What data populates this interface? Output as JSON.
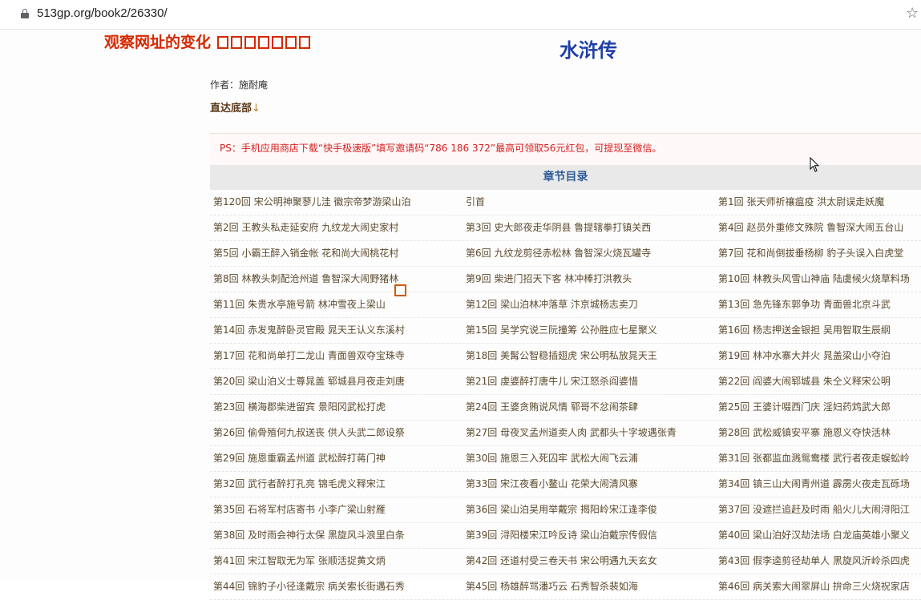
{
  "browser": {
    "url": "513gp.org/book2/26330/"
  },
  "overlay": {
    "title": "观察网址的变化"
  },
  "book": {
    "title": "水浒传",
    "author": "作者：施耐庵",
    "go_bottom": "直达底部",
    "go_bottom_arrow": "↓"
  },
  "ps": {
    "text": "PS：手机应用商店下载“快手极速版”填写邀请码“786 186 372”最高可领取56元红包，可提现至微信。"
  },
  "toc": {
    "header": "章节目录",
    "rows": [
      [
        "第120回 宋公明神聚蓼儿洼 徽宗帝梦游梁山泊",
        "引首",
        "第1回 张天师祈禳瘟疫 洪太尉误走妖魔"
      ],
      [
        "第2回 王教头私走延安府 九纹龙大闹史家村",
        "第3回 史大郎夜走华阴县 鲁提辖拳打镇关西",
        "第4回 赵员外重修文殊院 鲁智深大闹五台山"
      ],
      [
        "第5回 小霸王醉入销金帐 花和尚大闹桃花村",
        "第6回 九纹龙剪径赤松林 鲁智深火烧瓦罐寺",
        "第7回 花和尚倒拔垂杨柳 豹子头误入白虎堂"
      ],
      [
        "第8回 林教头刺配沧州道 鲁智深大闹野猪林",
        "第9回 柴进门招天下客 林冲棒打洪教头",
        "第10回 林教头风雪山神庙 陆虞候火烧草料场"
      ],
      [
        "第11回 朱贵水亭施号箭 林冲雪夜上梁山",
        "第12回 梁山泊林冲落草 汴京城杨志卖刀",
        "第13回 急先锋东郭争功 青面兽北京斗武"
      ],
      [
        "第14回 赤发鬼醉卧灵官殿 晁天王认义东溪村",
        "第15回 吴学究说三阮撞筹 公孙胜应七星聚义",
        "第16回 杨志押送金银担 吴用智取生辰纲"
      ],
      [
        "第17回 花和尚单打二龙山 青面兽双夺宝珠寺",
        "第18回 美髯公智稳插翅虎 宋公明私放晁天王",
        "第19回 林冲水寨大并火 晁盖梁山小夺泊"
      ],
      [
        "第20回 梁山泊义士尊晁盖 郓城县月夜走刘唐",
        "第21回 虔婆醉打唐牛儿 宋江怒杀阎婆惜",
        "第22回 阎婆大闹郓城县 朱仝义释宋公明"
      ],
      [
        "第23回 横海郡柴进留宾 景阳冈武松打虎",
        "第24回 王婆贪贿说风情 郓哥不忿闹茶肆",
        "第25回 王婆计啜西门庆 淫妇药鸩武大郎"
      ],
      [
        "第26回 偷骨殖何九叔送丧 供人头武二郎设祭",
        "第27回 母夜叉孟州道卖人肉 武都头十字坡遇张青",
        "第28回 武松威镇安平寨 施恩义夺快活林"
      ],
      [
        "第29回 施恩重霸孟州道 武松醉打蒋门神",
        "第30回 施恩三入死囚牢 武松大闹飞云浦",
        "第31回 张都监血溅鸳鸯楼 武行者夜走蜈蚣岭"
      ],
      [
        "第32回 武行者醉打孔亮 锦毛虎义释宋江",
        "第33回 宋江夜看小鳌山 花荣大闹清风寨",
        "第34回 镇三山大闹青州道 霹雳火夜走瓦砾场"
      ],
      [
        "第35回 石将军村店寄书 小李广梁山射雁",
        "第36回 梁山泊吴用举戴宗 揭阳岭宋江逢李俊",
        "第37回 没遮拦追赶及时雨 船火儿大闹浔阳江"
      ],
      [
        "第38回 及时雨会神行太保 黑旋风斗浪里白条",
        "第39回 浔阳楼宋江吟反诗 梁山泊戴宗传假信",
        "第40回 梁山泊好汉劫法场 白龙庙英雄小聚义"
      ],
      [
        "第41回 宋江智取无为军 张顺活捉黄文炳",
        "第42回 还道村受三卷天书 宋公明遇九天玄女",
        "第43回 假李逵剪径劫单人 黑旋风沂岭杀四虎"
      ],
      [
        "第44回 锦豹子小径逢戴宗 病关索长街遇石秀",
        "第45回 杨雄醉骂潘巧云 石秀智杀裴如海",
        "第46回 病关索大闹翠屏山 拚命三火烧祝家店"
      ]
    ]
  }
}
